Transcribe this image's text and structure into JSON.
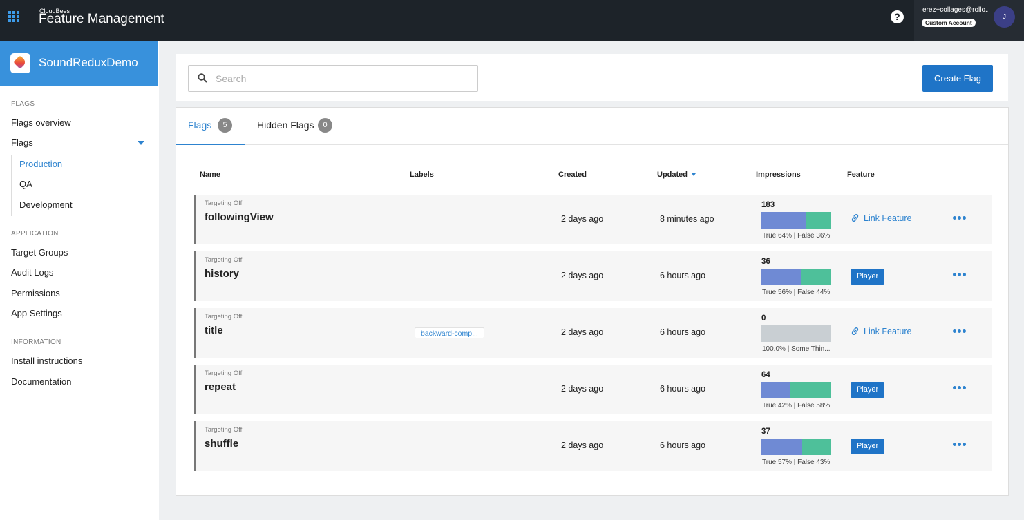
{
  "topbar": {
    "brand_small": "CloudBees",
    "brand_big": "Feature Management",
    "help_symbol": "?",
    "account_email": "erez+collages@rollo...",
    "account_badge": "Custom Account",
    "avatar_initial": "J"
  },
  "sidebar": {
    "app_name": "SoundReduxDemo",
    "sections": {
      "flags": "FLAGS",
      "application": "APPLICATION",
      "information": "INFORMATION"
    },
    "flags_overview": "Flags overview",
    "flags": "Flags",
    "environments": [
      "Production",
      "QA",
      "Development"
    ],
    "active_environment": "Production",
    "application_items": [
      "Target Groups",
      "Audit Logs",
      "Permissions",
      "App Settings"
    ],
    "information_items": [
      "Install instructions",
      "Documentation"
    ]
  },
  "search": {
    "placeholder": "Search",
    "value": ""
  },
  "create_button": "Create Flag",
  "tabs": [
    {
      "label": "Flags",
      "count": "5",
      "active": true
    },
    {
      "label": "Hidden Flags",
      "count": "0",
      "active": false
    }
  ],
  "columns": {
    "name": "Name",
    "labels": "Labels",
    "created": "Created",
    "updated": "Updated",
    "impressions": "Impressions",
    "feature": "Feature"
  },
  "flags": [
    {
      "status": "Targeting Off",
      "name": "followingView",
      "label": "",
      "created": "2 days ago",
      "updated": "8 minutes ago",
      "impressions": "183",
      "true_fraction": 0.64,
      "impressions_text": "True 64% | False 36%",
      "feature": "Link Feature",
      "feature_is_link": true
    },
    {
      "status": "Targeting Off",
      "name": "history",
      "label": "",
      "created": "2 days ago",
      "updated": "6 hours ago",
      "impressions": "36",
      "true_fraction": 0.56,
      "impressions_text": "True 56% | False 44%",
      "feature": "Player",
      "feature_is_link": false
    },
    {
      "status": "Targeting Off",
      "name": "title",
      "label": "backward-comp...",
      "created": "2 days ago",
      "updated": "6 hours ago",
      "impressions": "0",
      "true_fraction": 0,
      "impressions_text": "100.0% | Some Thin...",
      "feature": "Link Feature",
      "feature_is_link": true,
      "empty_bar": true
    },
    {
      "status": "Targeting Off",
      "name": "repeat",
      "label": "",
      "created": "2 days ago",
      "updated": "6 hours ago",
      "impressions": "64",
      "true_fraction": 0.42,
      "impressions_text": "True 42% | False 58%",
      "feature": "Player",
      "feature_is_link": false
    },
    {
      "status": "Targeting Off",
      "name": "shuffle",
      "label": "",
      "created": "2 days ago",
      "updated": "6 hours ago",
      "impressions": "37",
      "true_fraction": 0.57,
      "impressions_text": "True 57% | False 43%",
      "feature": "Player",
      "feature_is_link": false
    }
  ],
  "colors": {
    "accent": "#2d83cf",
    "primary_button": "#1f74c7",
    "true_segment": "#6f8ad4",
    "false_segment": "#4ec09a",
    "topbar": "#1d2329"
  }
}
